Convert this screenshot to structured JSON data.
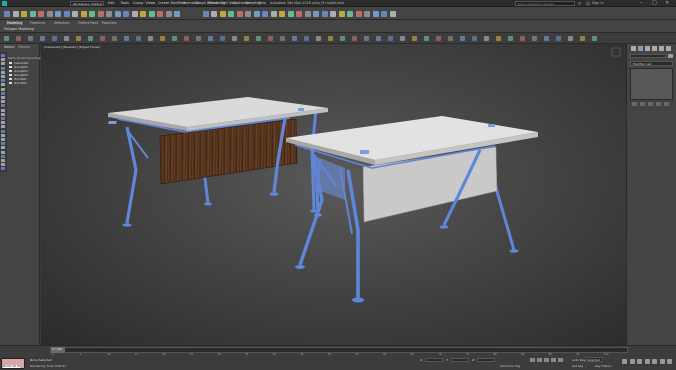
{
  "window": {
    "title": "Autodesk 3ds Max 2018    untq_M model.max",
    "search_placeholder": "Type a keyword or phrase",
    "sign_in": "Sign In"
  },
  "menu": [
    "Edit",
    "Tools",
    "Group",
    "Views",
    "Create",
    "Modifiers",
    "Animation",
    "Graph Editors",
    "Rendering",
    "Civil View",
    "Customize",
    "Scripting",
    "Help"
  ],
  "workspace": "Workspace: Default",
  "ribbon_tabs": [
    "Modeling",
    "Freeform",
    "Selection",
    "Object Paint",
    "Populate"
  ],
  "ribbon_sub": "Polygon Modeling",
  "scene": {
    "tabs": [
      "Select",
      "Display"
    ],
    "header": "Name (Sorted Ascending)",
    "items": [
      "Camera01",
      "Group002",
      "Group001",
      "Group003",
      "Omni001",
      "Omni002"
    ]
  },
  "viewport": {
    "label": "[Camera01] [Realistic] [Edged Faces]"
  },
  "modifier_list": "Modifier List",
  "status": {
    "none_selected": "None Selected",
    "rendering_time": "Rendering Time 0:00:01",
    "frame": "0 / 100",
    "add_time_tag": "Add Time Tag",
    "auto_key": "Auto Key",
    "set_key": "Set Key",
    "selected": "Selected",
    "key_filters": "Key Filters..."
  },
  "timeline_ticks": [
    "0",
    "5",
    "10",
    "15",
    "20",
    "25",
    "30",
    "35",
    "40",
    "45",
    "50",
    "55",
    "60",
    "65",
    "70",
    "75",
    "80",
    "85",
    "90",
    "95",
    "100"
  ],
  "coords": {
    "x_label": "X:",
    "y_label": "Y:",
    "z_label": "Z:"
  },
  "maxscript": "MAXScript Mi"
}
